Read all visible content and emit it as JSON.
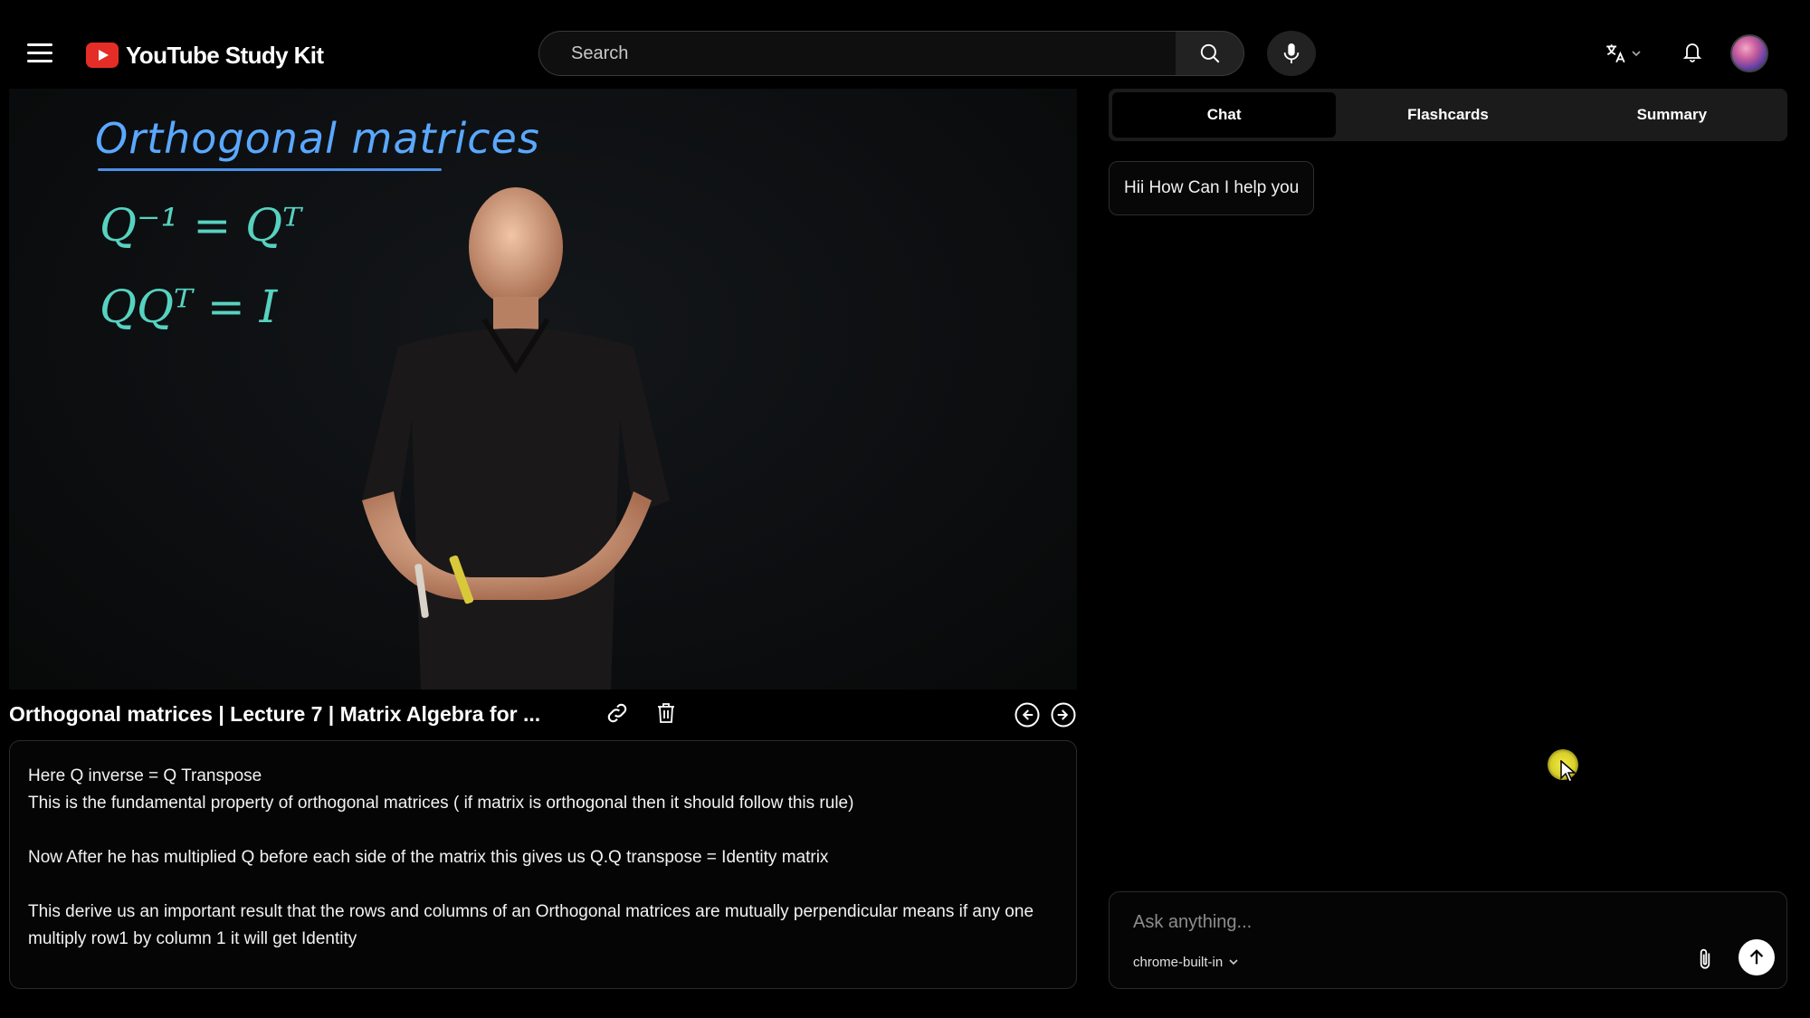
{
  "header": {
    "logo_text": "YouTube Study Kit",
    "search_placeholder": "Search"
  },
  "video": {
    "board_title": "Orthogonal matrices",
    "equation_1": "Q⁻¹ = Qᵀ",
    "equation_2": "QQᵀ = I",
    "title": "Orthogonal matrices | Lecture 7 | Matrix Algebra for ..."
  },
  "notes": {
    "paragraphs": [
      "Here Q inverse = Q Transpose",
      "This is the fundamental property of orthogonal matrices ( if matrix is orthogonal then it should follow this rule)",
      "Now After he has multiplied Q before each side of the matrix this gives us Q.Q transpose = Identity matrix",
      "This derive us an important result that the rows and columns of an Orthogonal matrices are mutually perpendicular means if any one multiply row1 by column 1 it will get Identity"
    ]
  },
  "panel": {
    "tabs": [
      {
        "label": "Chat",
        "active": true
      },
      {
        "label": "Flashcards",
        "active": false
      },
      {
        "label": "Summary",
        "active": false
      }
    ],
    "chat_messages": [
      {
        "text": "Hii How Can I help you"
      }
    ],
    "composer": {
      "placeholder": "Ask anything...",
      "model": "chrome-built-in"
    }
  },
  "icons": {
    "menu": "menu-icon",
    "search": "search-icon",
    "mic": "mic-icon",
    "translate": "translate-icon",
    "bell": "bell-icon",
    "link": "link-icon",
    "trash": "trash-icon",
    "prev": "arrow-left-circle-icon",
    "next": "arrow-right-circle-icon",
    "attach": "paperclip-icon",
    "send": "arrow-up-icon"
  },
  "colors": {
    "accent_red": "#e52d27",
    "board_blue": "#5aa8ff",
    "board_teal": "#57d2c0",
    "cursor_yellow": "#f2ea46"
  }
}
